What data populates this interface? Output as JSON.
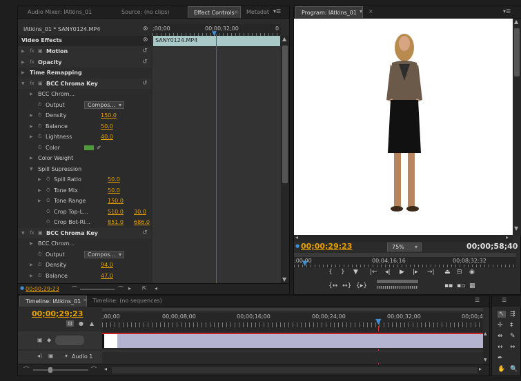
{
  "source_panel": {
    "tabs": [
      "Audio Mixer: lAtkins_01",
      "Source: (no clips)",
      "Effect Controls",
      "Metadat"
    ],
    "clip_title": "lAtkins_01 * SANY0124.MP4",
    "section_title": "Video Effects",
    "ruler_labels": [
      ";00;00",
      "00;00;32;00",
      "0"
    ],
    "clip_bar_label": "SANY0124.MP4",
    "footer_timecode": "00;00;29;23",
    "rows": [
      {
        "label": "Motion",
        "kind": "effect"
      },
      {
        "label": "Opacity",
        "kind": "effect"
      },
      {
        "label": "Time Remapping",
        "kind": "plain"
      },
      {
        "label": "BCC Chroma Key",
        "kind": "effect"
      },
      {
        "label": "BCC Chrom...",
        "kind": "sub"
      },
      {
        "label": "Output",
        "kind": "dropdown",
        "value": "Compos..."
      },
      {
        "label": "Density",
        "kind": "value",
        "value": "150.0"
      },
      {
        "label": "Balance",
        "kind": "value",
        "value": "50.0"
      },
      {
        "label": "Lightness",
        "kind": "value",
        "value": "40.0"
      },
      {
        "label": "Color",
        "kind": "color"
      },
      {
        "label": "Color Weight",
        "kind": "sub"
      },
      {
        "label": "Spill Supression",
        "kind": "group"
      },
      {
        "label": "Spill Ratio",
        "kind": "value",
        "value": "50.0"
      },
      {
        "label": "Tone Mix",
        "kind": "value",
        "value": "50.0"
      },
      {
        "label": "Tone Range",
        "kind": "value",
        "value": "150.0"
      },
      {
        "label": "Crop Top-L...",
        "kind": "value2",
        "value": "510.0",
        "value2": "30.0"
      },
      {
        "label": "Crop Bot-Ri...",
        "kind": "value2",
        "value": "851.0",
        "value2": "686.0"
      },
      {
        "label": "BCC Chroma Key",
        "kind": "effect"
      },
      {
        "label": "BCC Chrom...",
        "kind": "sub"
      },
      {
        "label": "Output",
        "kind": "dropdown",
        "value": "Compos..."
      },
      {
        "label": "Density",
        "kind": "value",
        "value": "94.0"
      },
      {
        "label": "Balance",
        "kind": "value",
        "value": "47.0"
      }
    ]
  },
  "program_panel": {
    "tab": "Program: lAtkins_01",
    "current_time": "00;00;29;23",
    "zoom": "75%",
    "duration": "00;00;58;40",
    "ruler_labels": [
      ";00;00",
      "00;04;16;16",
      "00;08;32;32"
    ],
    "colors": {
      "accent_timecode": "#e8a000",
      "playhead": "#3e8fd8"
    }
  },
  "timeline_panel": {
    "tabs": [
      "Timeline: lAtkins_01",
      "Timeline: (no sequences)"
    ],
    "current_time": "00;00;29;23",
    "ruler_labels": [
      ";00;00",
      "00;00;08;00",
      "00;00;16;00",
      "00;00;24;00",
      "00;00;32;00",
      "00;00;4"
    ],
    "audio_track_label": "Audio 1"
  }
}
